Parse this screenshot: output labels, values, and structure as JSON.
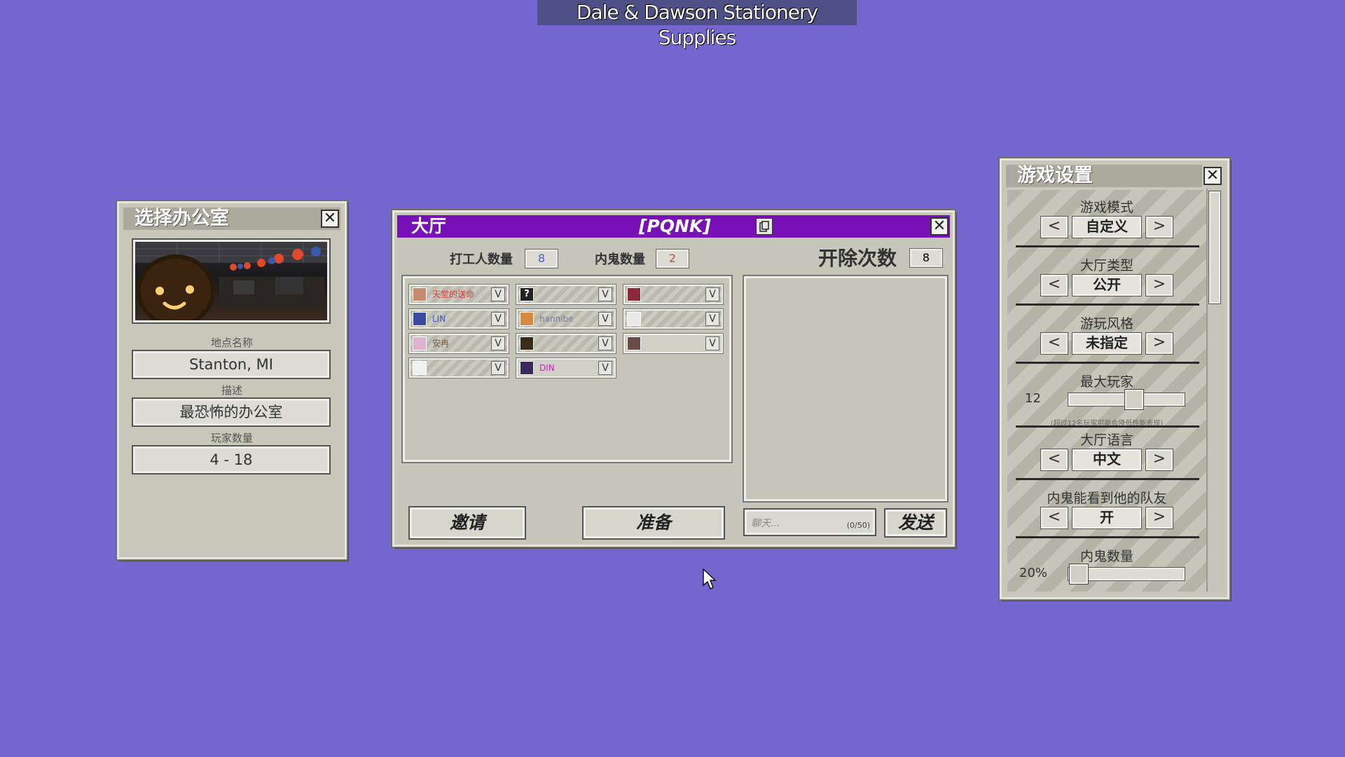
{
  "app_title": "Dale & Dawson Stationery Supplies",
  "office_panel": {
    "title": "选择办公室",
    "location_label": "地点名称",
    "location_value": "Stanton, MI",
    "description_label": "描述",
    "description_value": "最恐怖的办公室",
    "players_label": "玩家数量",
    "players_value": "4 - 18"
  },
  "lobby": {
    "title": "大厅",
    "code": "[PQNK]",
    "workers_label": "打工人数量",
    "workers_value": "8",
    "impostors_label": "内鬼数量",
    "impostors_value": "2",
    "fire_label": "开除次数",
    "fire_value": "8",
    "players": [
      {
        "name": "天堂的送命",
        "avatar": "",
        "avatar_color": "#c98a70",
        "name_color": "#d43a3a",
        "striped": true
      },
      {
        "name": "",
        "avatar": "?",
        "avatar_color": "#222222",
        "name_color": "#5a6adf",
        "striped": true
      },
      {
        "name": "",
        "avatar": "",
        "avatar_color": "#8a2a3a",
        "name_color": "#3aa64a",
        "striped": true
      },
      {
        "name": "LIN",
        "avatar": "",
        "avatar_color": "#3a4aa0",
        "name_color": "#4a5ab0",
        "striped": true
      },
      {
        "name": "hannibe",
        "avatar": "",
        "avatar_color": "#d88a40",
        "name_color": "#7a7a9a",
        "striped": true
      },
      {
        "name": "",
        "avatar": "",
        "avatar_color": "#e8e8e8",
        "name_color": "#2abfbf",
        "striped": true
      },
      {
        "name": "安冉",
        "avatar": "",
        "avatar_color": "#e0b0d0",
        "name_color": "#7a5a4a",
        "striped": true
      },
      {
        "name": "",
        "avatar": "",
        "avatar_color": "#3a2a1a",
        "name_color": "#c09a6a",
        "striped": true
      },
      {
        "name": "",
        "avatar": "",
        "avatar_color": "#6a4a4a",
        "name_color": "#e08aa0",
        "striped": false
      },
      {
        "name": "",
        "avatar": "",
        "avatar_color": "#f0f0f0",
        "name_color": "#9ac04a",
        "striped": true
      },
      {
        "name": "DIN",
        "avatar": "",
        "avatar_color": "#3a2a5a",
        "name_color": "#c020c0",
        "striped": false
      }
    ],
    "player_toggle": "V",
    "invite_button": "邀请",
    "ready_button": "准备",
    "chat_placeholder": "聊天...",
    "chat_counter": "(0/50)",
    "send_button": "发送"
  },
  "settings": {
    "title": "游戏设置",
    "game_mode_label": "游戏模式",
    "game_mode_value": "自定义",
    "lobby_type_label": "大厅类型",
    "lobby_type_value": "公开",
    "play_style_label": "游玩风格",
    "play_style_value": "未指定",
    "max_players_label": "最大玩家",
    "max_players_value": "12",
    "max_players_level": 0.58,
    "max_players_note": "(超过12名玩家可能会降低性能表现)",
    "lobby_language_label": "大厅语言",
    "lobby_language_value": "中文",
    "impostor_teammates_label": "内鬼能看到他的队友",
    "impostor_teammates_value": "开",
    "impostor_count_label": "内鬼数量",
    "impostor_count_value": "20%",
    "impostor_count_level": 0.0,
    "prev_arrow": "<",
    "next_arrow": ">"
  }
}
